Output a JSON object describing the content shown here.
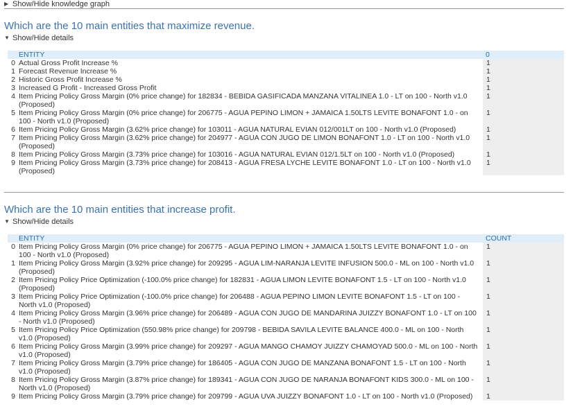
{
  "knowledge_graph_toggle": "Show/Hide knowledge graph",
  "section1": {
    "title": "Which are the 10 main entities that maximize revenue.",
    "details_toggle": "Show/Hide details",
    "col_entity": "ENTITY",
    "col_value": "0",
    "rows": [
      {
        "idx": "0",
        "entity": "Actual Gross Profit Increase %",
        "value": "1"
      },
      {
        "idx": "1",
        "entity": "Forecast Revenue Increase %",
        "value": "1"
      },
      {
        "idx": "2",
        "entity": "Historic Gross Profit Increase %",
        "value": "1"
      },
      {
        "idx": "3",
        "entity": "Increased G Profit - Increased Gross Profit",
        "value": "1"
      },
      {
        "idx": "4",
        "entity": "Item Pricing Policy Gross Margin (0% price change) for 182834 - BEBIDA GASIFICADA MANZANA VITALINEA 1.0 - LT on 100 - North v1.0 (Proposed)",
        "value": "1"
      },
      {
        "idx": "5",
        "entity": "Item Pricing Policy Gross Margin (0% price change) for 206775 - AGUA PEPINO LIMON + JAMAICA 1.50LTS LEVITE BONAFONT 1.0 - on 100 - North v1.0 (Proposed)",
        "value": "1"
      },
      {
        "idx": "6",
        "entity": "Item Pricing Policy Gross Margin (3.62% price change) for 103011 - AGUA NATURAL EVIAN 012/001LT on 100 - North v1.0 (Proposed)",
        "value": "1"
      },
      {
        "idx": "7",
        "entity": "Item Pricing Policy Gross Margin (3.62% price change) for 204977 - AGUA CON JUGO DE LIMON BONAFONT 1.0 - LT on 100 - North v1.0 (Proposed)",
        "value": "1"
      },
      {
        "idx": "8",
        "entity": "Item Pricing Policy Gross Margin (3.73% price change) for 103016 - AGUA NATURAL EVIAN 012/1.5LT on 100 - North v1.0 (Proposed)",
        "value": "1"
      },
      {
        "idx": "9",
        "entity": "Item Pricing Policy Gross Margin (3.73% price change) for 208413 - AGUA FRESA LYCHE LEVITE BONAFONT 1.0 - LT on 100 - North v1.0 (Proposed)",
        "value": "1"
      }
    ]
  },
  "section2": {
    "title": "Which are the 10 main entities that increase profit.",
    "details_toggle": "Show/Hide details",
    "col_entity": "ENTITY",
    "col_value": "COUNT",
    "rows": [
      {
        "idx": "0",
        "entity": "Item Pricing Policy Gross Margin (0% price change) for 206775 - AGUA PEPINO LIMON + JAMAICA 1.50LTS LEVITE BONAFONT 1.0 - on 100 - North v1.0 (Proposed)",
        "value": "1"
      },
      {
        "idx": "1",
        "entity": "Item Pricing Policy Gross Margin (3.92% price change) for 209295 - AGUA LIM-NARANJA LEVITE INFUSION 500.0 - ML on 100 - North v1.0 (Proposed)",
        "value": "1"
      },
      {
        "idx": "2",
        "entity": "Item Pricing Policy Price Optimization (-100.0% price change) for 182831 - AGUA LIMON LEVITE BONAFONT 1.5 - LT on 100 - North v1.0 (Proposed)",
        "value": "1"
      },
      {
        "idx": "3",
        "entity": "Item Pricing Policy Price Optimization (-100.0% price change) for 206488 - AGUA PEPINO LIMON LEVITE BONAFONT 1.5 - LT on 100 - North v1.0 (Proposed)",
        "value": "1"
      },
      {
        "idx": "4",
        "entity": "Item Pricing Policy Gross Margin (3.96% price change) for 206489 - AGUA CON JUGO DE MANDARINA JUIZZY BONAFONT 1.0 - LT on 100 - North v1.0 (Proposed)",
        "value": "1"
      },
      {
        "idx": "5",
        "entity": "Item Pricing Policy Price Optimization (550.98% price change) for 209798 - BEBIDA SAVILA LEVITE BALANCE 400.0 - ML on 100 - North v1.0 (Proposed)",
        "value": "1"
      },
      {
        "idx": "6",
        "entity": "Item Pricing Policy Gross Margin (3.99% price change) for 209297 - AGUA MANGO CHAMOY JUIZZY CHAMOYAD 500.0 - ML on 100 - North v1.0 (Proposed)",
        "value": "1"
      },
      {
        "idx": "7",
        "entity": "Item Pricing Policy Gross Margin (3.79% price change) for 186405 - AGUA CON JUGO DE MANZANA BONAFONT 1.5 - LT on 100 - North v1.0 (Proposed)",
        "value": "1"
      },
      {
        "idx": "8",
        "entity": "Item Pricing Policy Gross Margin (3.87% price change) for 189341 - AGUA CON JUGO DE NARANJA BONAFONT KIDS 300.0 - ML on 100 - North v1.0 (Proposed)",
        "value": "1"
      },
      {
        "idx": "9",
        "entity": "Item Pricing Policy Gross Margin (3.79% price change) for 209799 - AGUA UVA JUIZZY BONAFONT 1.0 - LT on 100 - North v1.0 (Proposed)",
        "value": "1"
      }
    ]
  }
}
